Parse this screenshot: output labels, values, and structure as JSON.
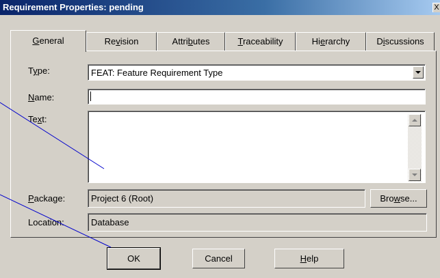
{
  "window": {
    "title": "Requirement Properties: pending",
    "close_glyph": "X"
  },
  "tabs": [
    {
      "label": "General",
      "accel": "G",
      "rest": "eneral",
      "pre": "",
      "active": true
    },
    {
      "label": "Revision",
      "pre": "Re",
      "accel": "v",
      "rest": "ision"
    },
    {
      "label": "Attributes",
      "pre": "Attri",
      "accel": "b",
      "rest": "utes"
    },
    {
      "label": "Traceability",
      "pre": "",
      "accel": "T",
      "rest": "raceability"
    },
    {
      "label": "Hierarchy",
      "pre": "Hi",
      "accel": "e",
      "rest": "rarchy"
    },
    {
      "label": "Discussions",
      "pre": "D",
      "accel": "i",
      "rest": "scussions"
    }
  ],
  "form": {
    "type_label": {
      "pre": "T",
      "accel": "y",
      "rest": "pe:"
    },
    "type_value": "FEAT: Feature Requirement Type",
    "name_label": {
      "pre": "",
      "accel": "N",
      "rest": "ame:"
    },
    "name_value": "",
    "text_label": {
      "pre": "Te",
      "accel": "x",
      "rest": "t:"
    },
    "text_value": "",
    "package_label": {
      "pre": "",
      "accel": "P",
      "rest": "ackage:"
    },
    "package_value": "Project 6 (Root)",
    "location_label": "Location:",
    "location_value": "Database"
  },
  "buttons": {
    "browse": {
      "pre": "Bro",
      "accel": "w",
      "rest": "se..."
    },
    "ok": "OK",
    "cancel": "Cancel",
    "help": {
      "pre": "",
      "accel": "H",
      "rest": "elp"
    }
  },
  "colors": {
    "face": "#d4d0c8",
    "titlebar_start": "#0a246a",
    "titlebar_end": "#a6caf0",
    "annotation_line": "#0000cc"
  }
}
